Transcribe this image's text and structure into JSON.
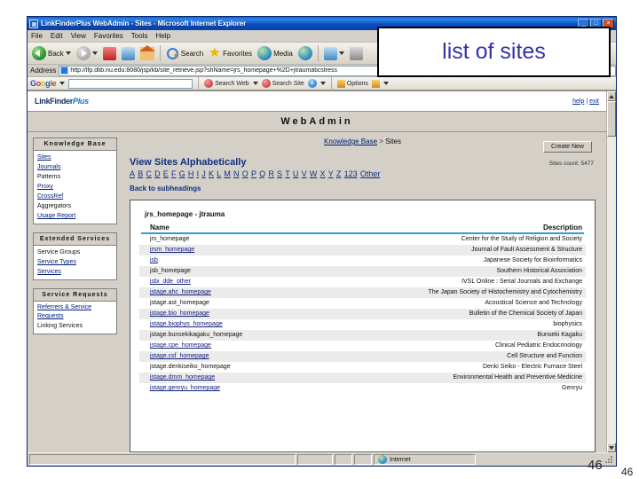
{
  "window": {
    "title": "LinkFinderPlus WebAdmin - Sites - Microsoft Internet Explorer",
    "minimize": "_",
    "maximize": "□",
    "close": "×"
  },
  "menubar": [
    "File",
    "Edit",
    "View",
    "Favorites",
    "Tools",
    "Help"
  ],
  "toolbar": {
    "back": "Back",
    "forward": "",
    "stop": "",
    "refresh": "",
    "home": "",
    "search": "Search",
    "favorites": "Favorites",
    "media": "Media",
    "history": ""
  },
  "address": {
    "label": "Address",
    "url": "http://lfp.dlib.nu.edu:8080/jsp/kb/site_retrieve.jsp?shName=jrs_homepage+%2D+jtraumaticstress"
  },
  "google_bar": {
    "logo": [
      "G",
      "o",
      "o",
      "g",
      "l",
      "e"
    ],
    "search_box_value": "",
    "search_web": "Search Web",
    "search_site": "Search Site",
    "info": "i",
    "options": "Options"
  },
  "page": {
    "brand": "LinkFinder",
    "brand_suffix": "Plus",
    "help": "help",
    "divider": "|",
    "exit": "exit",
    "banner": "WebAdmin"
  },
  "sidebar": {
    "boxes": [
      {
        "title": "Knowledge Base",
        "items": [
          {
            "label": "Sites",
            "link": true
          },
          {
            "label": "Journals",
            "link": true
          },
          {
            "label": "Patterns",
            "link": false
          },
          {
            "label": "Proxy",
            "link": true
          },
          {
            "label": "CrossRef",
            "link": true
          },
          {
            "label": "Aggregators",
            "link": false
          },
          {
            "label": "Usage Report",
            "link": true
          }
        ]
      },
      {
        "title": "Extended Services",
        "items": [
          {
            "label": "Service Groups",
            "link": false
          },
          {
            "label": "Service Types",
            "link": true
          },
          {
            "label": "Services",
            "link": true
          }
        ]
      },
      {
        "title": "Service Requests",
        "items": [
          {
            "label": "Referrers & Service Requests",
            "link": true
          },
          {
            "label": "Linking Services",
            "link": false
          }
        ]
      }
    ]
  },
  "main": {
    "breadcrumb_root": "Knowledge Base",
    "breadcrumb_sep": ">",
    "breadcrumb_current": "Sites",
    "create_new": "Create New",
    "heading": "View Sites Alphabetically",
    "sites_count": "Sites count: 5477",
    "alphabet": [
      "A",
      "B",
      "C",
      "D",
      "E",
      "F",
      "G",
      "H",
      "I",
      "J",
      "K",
      "L",
      "M",
      "N",
      "O",
      "P",
      "Q",
      "R",
      "S",
      "T",
      "U",
      "V",
      "W",
      "X",
      "Y",
      "Z",
      "123",
      "Other"
    ],
    "back_to_subheadings": "Back to subheadings",
    "subheading": "jrs_homepage - jtrauma",
    "columns": [
      "Name",
      "Description"
    ],
    "rows": [
      {
        "name": "jrs_homepage",
        "link": false,
        "description": "Center for the Study of Religion and Society"
      },
      {
        "name": "jrsm_homepage",
        "link": true,
        "description": "Journal of Fault Assessment & Structure"
      },
      {
        "name": "jsb",
        "link": true,
        "description": "Japanese Society for Bioinformatics"
      },
      {
        "name": "jsb_homepage",
        "link": false,
        "description": "Southern Historical Association"
      },
      {
        "name": "jsbi_dde_other",
        "link": true,
        "description": "IVSL Online : Serial Journals and Exchange"
      },
      {
        "name": "jstage.ahc_homepage",
        "link": true,
        "description": "The Japan Society of Histochemistry and Cytochemistry"
      },
      {
        "name": "jstage.ast_homepage",
        "link": false,
        "description": "Acoustical Science and Technology"
      },
      {
        "name": "jstage.bio_homepage",
        "link": true,
        "description": "Bulletin of the Chemical Society of Japan"
      },
      {
        "name": "jstage.biophys_homepage",
        "link": true,
        "description": "biophysics"
      },
      {
        "name": "jstage.bunsekikagaku_homepage",
        "link": false,
        "description": "Bunseki Kagaku"
      },
      {
        "name": "jstage.cpe_homepage",
        "link": true,
        "description": "Clinical Pediatric Endocrinology"
      },
      {
        "name": "jstage.csf_homepage",
        "link": true,
        "description": "Cell Structure and Function"
      },
      {
        "name": "jstage.denkiseiko_homepage",
        "link": false,
        "description": "Denki Seiko - Electric Furnace Steel"
      },
      {
        "name": "jstage.dmm_homepage",
        "link": true,
        "description": "Environmental Health and Preventive Medicine"
      },
      {
        "name": "jstage.genryu_homepage",
        "link": true,
        "description": "Genryu"
      }
    ]
  },
  "statusbar": {
    "zone": "Internet"
  },
  "callout": {
    "text": "list of sites"
  },
  "slide": {
    "number_primary": "46",
    "number_secondary": "46"
  }
}
